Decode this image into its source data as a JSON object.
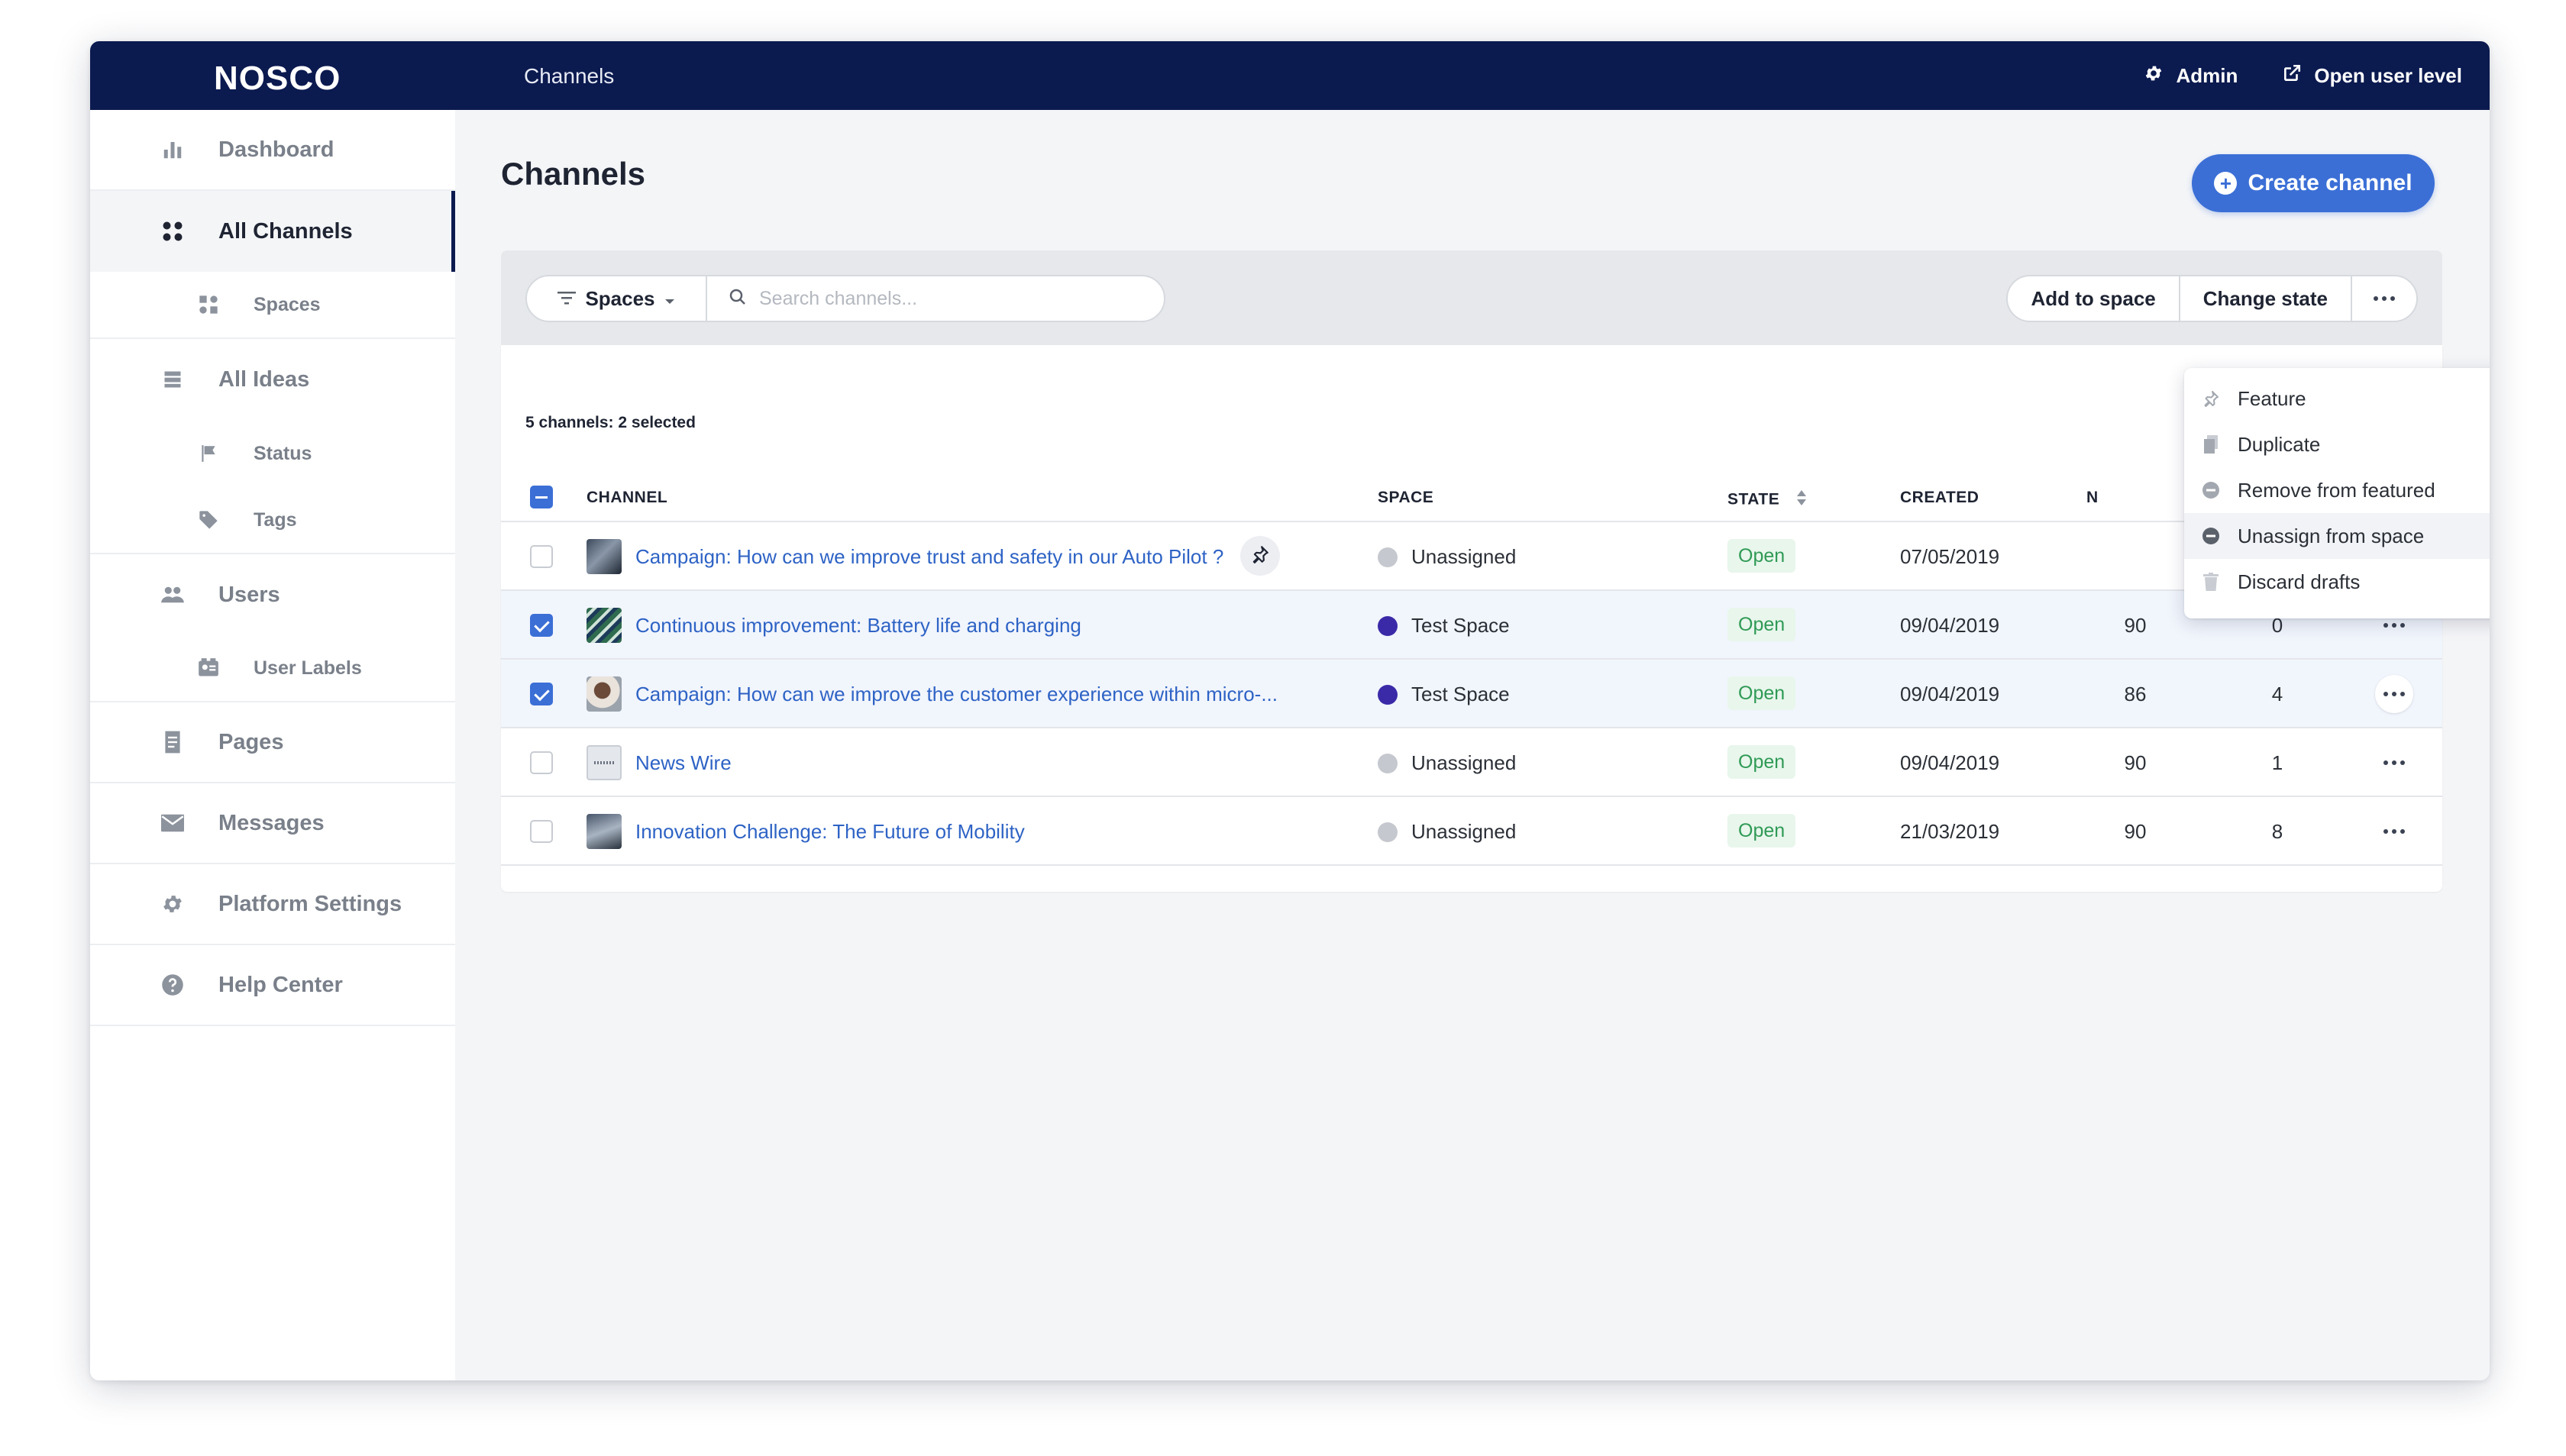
{
  "app": {
    "logo": "NOSCO",
    "section_title": "Channels"
  },
  "topbar": {
    "admin_label": "Admin",
    "open_user_level_label": "Open user level"
  },
  "sidebar": {
    "items": [
      {
        "label": "Dashboard",
        "icon": "bar-chart-icon"
      },
      {
        "label": "All Channels",
        "icon": "grid-dots-icon",
        "active": true
      },
      {
        "label": "Spaces",
        "icon": "spaces-icon",
        "sub": true
      },
      {
        "label": "All Ideas",
        "icon": "list-icon"
      },
      {
        "label": "Status",
        "icon": "flag-icon",
        "sub": true
      },
      {
        "label": "Tags",
        "icon": "tag-icon",
        "sub": true
      },
      {
        "label": "Users",
        "icon": "users-icon"
      },
      {
        "label": "User Labels",
        "icon": "id-card-icon",
        "sub": true
      },
      {
        "label": "Pages",
        "icon": "document-icon"
      },
      {
        "label": "Messages",
        "icon": "envelope-icon"
      },
      {
        "label": "Platform Settings",
        "icon": "gear-icon"
      },
      {
        "label": "Help Center",
        "icon": "help-icon"
      }
    ]
  },
  "main": {
    "title": "Channels",
    "create_button": "Create channel",
    "filter": {
      "spaces_label": "Spaces",
      "search_placeholder": "Search channels..."
    },
    "actions": {
      "add_to_space": "Add to space",
      "change_state": "Change state"
    },
    "count_line": "5 channels: 2 selected",
    "columns": {
      "channel": "CHANNEL",
      "space": "SPACE",
      "state": "STATE",
      "created": "CREATED",
      "partial": "N"
    },
    "rows": [
      {
        "title": "Campaign: How can we improve trust and safety in our Auto Pilot ?",
        "space": "Unassigned",
        "space_color": "#c5c8ce",
        "state": "Open",
        "created": "07/05/2019",
        "n1": "",
        "n2": "",
        "selected": false,
        "featured": true
      },
      {
        "title": "Continuous improvement: Battery life and charging",
        "space": "Test Space",
        "space_color": "#3a2aa8",
        "state": "Open",
        "created": "09/04/2019",
        "n1": "90",
        "n2": "0",
        "selected": true
      },
      {
        "title": "Campaign: How can we improve the customer experience within micro-...",
        "space": "Test Space",
        "space_color": "#3a2aa8",
        "state": "Open",
        "created": "09/04/2019",
        "n1": "86",
        "n2": "4",
        "selected": true
      },
      {
        "title": "News Wire",
        "space": "Unassigned",
        "space_color": "#c5c8ce",
        "state": "Open",
        "created": "09/04/2019",
        "n1": "90",
        "n2": "1",
        "selected": false
      },
      {
        "title": "Innovation Challenge: The Future of Mobility",
        "space": "Unassigned",
        "space_color": "#c5c8ce",
        "state": "Open",
        "created": "21/03/2019",
        "n1": "90",
        "n2": "8",
        "selected": false
      }
    ],
    "menu": [
      {
        "label": "Feature",
        "icon": "pin-icon"
      },
      {
        "label": "Duplicate",
        "icon": "copy-icon"
      },
      {
        "label": "Remove from featured",
        "icon": "minus-circle-icon"
      },
      {
        "label": "Unassign from space",
        "icon": "minus-circle-icon",
        "hover": true
      },
      {
        "label": "Discard drafts",
        "icon": "trash-icon"
      }
    ]
  },
  "colors": {
    "topbar": "#0b1a4f",
    "accent": "#3b6fd6",
    "link": "#2e63c5",
    "open_green": "#2f9a55"
  }
}
